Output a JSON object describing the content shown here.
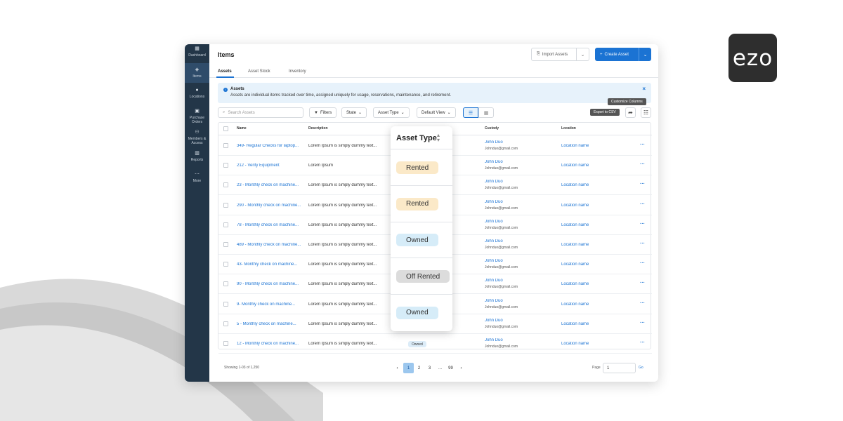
{
  "brand": {
    "logo_text": "ezo"
  },
  "sidebar": {
    "items": [
      {
        "label": "Dashboard",
        "icon": "grid-icon"
      },
      {
        "label": "Items",
        "icon": "box-icon",
        "active": true
      },
      {
        "label": "Locations",
        "icon": "pin-icon"
      },
      {
        "label": "Purchase Orders",
        "icon": "cart-icon"
      },
      {
        "label": "Members & Access",
        "icon": "users-icon"
      },
      {
        "label": "Reports",
        "icon": "chart-icon"
      },
      {
        "label": "More",
        "icon": "dots-icon"
      }
    ]
  },
  "header": {
    "title": "Items",
    "import_label": "Import Assets",
    "create_label": "Create Asset"
  },
  "tabs": [
    "Assets",
    "Asset Stock",
    "Inventory"
  ],
  "banner": {
    "title": "Assets",
    "body": "Assets are individual items tracked over time, assigned uniquely for usage, reservations, maintenance, and retirement."
  },
  "toolbar": {
    "search_placeholder": "Search Assets",
    "filters_label": "Filters",
    "state_label": "State",
    "asset_type_label": "Asset Type",
    "view_label": "Default View",
    "export_tip": "Export to CSV",
    "customize_tip": "Customize Columns"
  },
  "table": {
    "columns": [
      "Name",
      "Description",
      "Custody",
      "Location"
    ],
    "rows": [
      {
        "name": "349- Regular Checks for laptop...",
        "desc": "Lorem Ipsum is simply dummy text...",
        "custody": "John Duo",
        "email": "Johnduo@gmail.com",
        "location": "Location name"
      },
      {
        "name": "212 - Verify Equipment",
        "desc": "Lorem Ipsum",
        "custody": "John Duo",
        "email": "Johnduo@gmail.com",
        "location": "Location name"
      },
      {
        "name": "23 - Monthly check on machine...",
        "desc": "Lorem Ipsum is simply dummy text...",
        "custody": "John Duo",
        "email": "Johnduo@gmail.com",
        "location": "Location name"
      },
      {
        "name": "290 - Monthly check on machine...",
        "desc": "Lorem Ipsum is simply dummy text...",
        "custody": "John Duo",
        "email": "Johnduo@gmail.com",
        "location": "Location name"
      },
      {
        "name": "78 - Monthly check on machine...",
        "desc": "Lorem Ipsum is simply dummy text...",
        "custody": "John Duo",
        "email": "Johnduo@gmail.com",
        "location": "Location name"
      },
      {
        "name": "489 - Monthly check on machine...",
        "desc": "Lorem Ipsum is simply dummy text...",
        "custody": "John Duo",
        "email": "Johnduo@gmail.com",
        "location": "Location name"
      },
      {
        "name": "43- Monthly check on machine...",
        "desc": "Lorem Ipsum is simply dummy text...",
        "custody": "John Duo",
        "email": "Johnduo@gmail.com",
        "location": "Location name"
      },
      {
        "name": "90 - Monthly check on machine...",
        "desc": "Lorem Ipsum is simply dummy text...",
        "custody": "John Duo",
        "email": "Johnduo@gmail.com",
        "location": "Location name"
      },
      {
        "name": "9- Monthly check on machine...",
        "desc": "Lorem Ipsum is simply dummy text...",
        "custody": "John Duo",
        "email": "Johnduo@gmail.com",
        "location": "Location name"
      },
      {
        "name": "5 - Monthly check on machine...",
        "desc": "Lorem Ipsum is simply dummy text...",
        "custody": "John Duo",
        "email": "Johnduo@gmail.com",
        "location": "Location name"
      },
      {
        "name": "12 - Monthly check on machine...",
        "desc": "Lorem Ipsum is simply dummy text...",
        "custody": "John Duo",
        "email": "Johnduo@gmail.com",
        "location": "Location name",
        "asset_type": "Owned"
      }
    ]
  },
  "footer": {
    "showing": "Showing 1-03 of 1,250",
    "pages": [
      "1",
      "2",
      "3",
      "...",
      "99"
    ],
    "page_label": "Page",
    "page_value": "1",
    "go_label": "Go"
  },
  "asset_type_popup": {
    "title": "Asset Type",
    "items": [
      {
        "label": "Rented",
        "color": "#fbe9c8"
      },
      {
        "label": "Rented",
        "color": "#fbe9c8"
      },
      {
        "label": "Owned",
        "color": "#d6ecf8"
      },
      {
        "label": "Off Rented",
        "color": "#dcdcdc"
      },
      {
        "label": "Owned",
        "color": "#d6ecf8"
      }
    ]
  },
  "colors": {
    "primary": "#1b73d3",
    "sidebar": "#233648"
  }
}
